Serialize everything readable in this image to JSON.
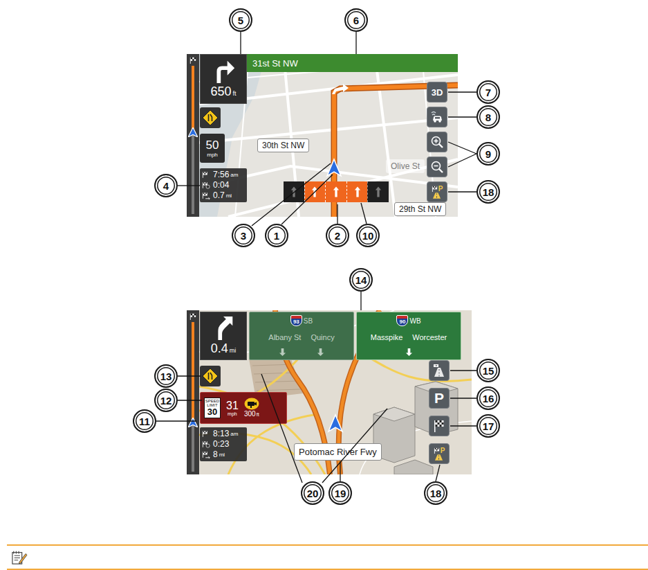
{
  "figure": {
    "screen_1": {
      "progress": {
        "level": 0.55
      },
      "turn": {
        "kind": "turn-right",
        "distance": "650",
        "unit": "ft"
      },
      "next_street": "31st St NW",
      "speed": {
        "value": "50",
        "unit": "mph"
      },
      "trip": [
        {
          "kind": "arrival",
          "value": "7:56",
          "unit": "am"
        },
        {
          "kind": "time-left",
          "value": "0:04"
        },
        {
          "kind": "distance-left",
          "value": "0.7",
          "unit": "mi"
        }
      ],
      "street_labels": [
        {
          "text": "30th St NW",
          "kind": "box"
        },
        {
          "text": "Olive St",
          "kind": "plain"
        },
        {
          "text": "29th St NW",
          "kind": "box"
        }
      ],
      "lanes": [
        {
          "selected": false
        },
        {
          "selected": true
        },
        {
          "selected": true
        },
        {
          "selected": true
        },
        {
          "selected": false
        }
      ],
      "buttons": [
        {
          "kind": "text",
          "label": "3D"
        },
        {
          "kind": "traffic"
        },
        {
          "kind": "zoom-in"
        },
        {
          "kind": "zoom-out"
        },
        {
          "kind": "poi",
          "label": "P"
        }
      ]
    },
    "screen_2": {
      "progress": {
        "level": 0.33
      },
      "turn": {
        "kind": "bear-right",
        "distance": "0.4",
        "unit": "mi"
      },
      "signs": [
        {
          "shield": "93",
          "direction": "SB",
          "destinations": [
            "Albany St",
            "Quincy"
          ],
          "arrows": 2,
          "selected": false
        },
        {
          "shield": "90",
          "direction": "WB",
          "destinations": [
            "Masspike",
            "Worcester"
          ],
          "arrows": 1,
          "selected": true
        }
      ],
      "speed_warning": {
        "caption": "SPEED LIMIT",
        "limit": "30",
        "current": "31",
        "unit": "mph",
        "camera_distance": "300",
        "camera_unit": "ft"
      },
      "trip": [
        {
          "kind": "arrival",
          "value": "8:13",
          "unit": "am"
        },
        {
          "kind": "time-left",
          "value": "0:23"
        },
        {
          "kind": "distance-left",
          "value": "8",
          "unit": "mi"
        }
      ],
      "street_labels": [
        {
          "text": "Potomac River Fwy",
          "kind": "box"
        }
      ],
      "buttons": [
        {
          "kind": "exit"
        },
        {
          "kind": "letter",
          "label": "P"
        },
        {
          "kind": "destination"
        },
        {
          "kind": "poi",
          "label": "P"
        }
      ]
    },
    "callouts": [
      "5",
      "6",
      "7",
      "8",
      "9",
      "18",
      "4",
      "3",
      "1",
      "2",
      "10",
      "14",
      "13",
      "15",
      "12",
      "16",
      "11",
      "17",
      "20",
      "19",
      "18"
    ]
  }
}
